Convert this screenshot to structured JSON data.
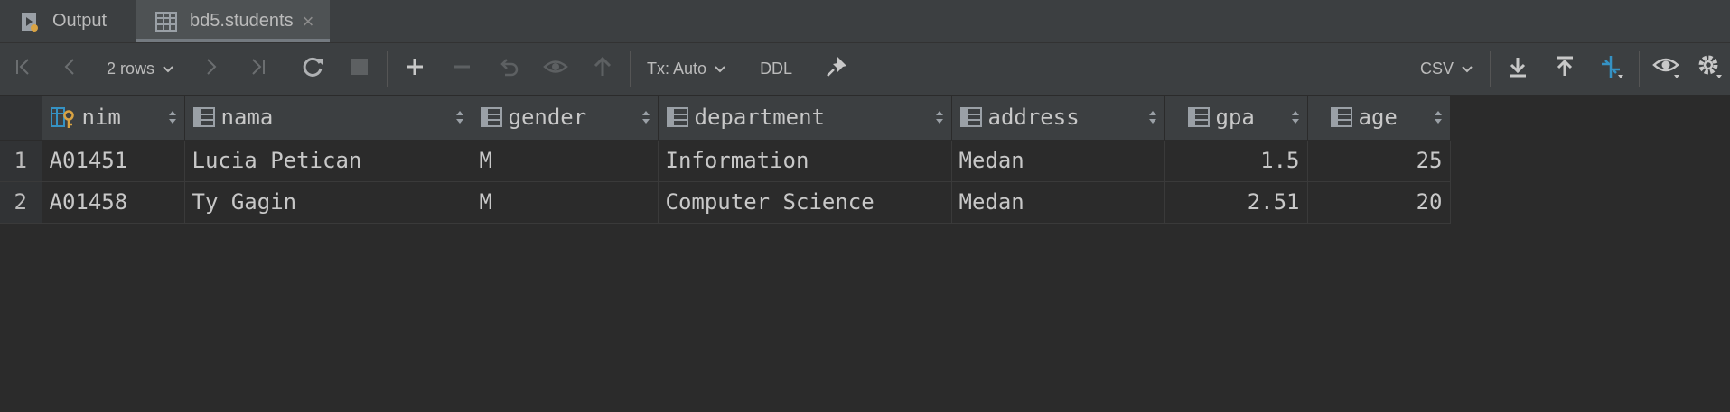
{
  "tabs": [
    {
      "label": "Output",
      "icon": "output-icon"
    },
    {
      "label": "bd5.students",
      "icon": "table-icon",
      "active": true
    }
  ],
  "toolbar": {
    "rows_label": "2 rows",
    "tx_label": "Tx: Auto",
    "ddl_label": "DDL",
    "csv_label": "CSV"
  },
  "table": {
    "columns": [
      {
        "name": "nim",
        "key": true
      },
      {
        "name": "nama"
      },
      {
        "name": "gender"
      },
      {
        "name": "department"
      },
      {
        "name": "address"
      },
      {
        "name": "gpa",
        "numeric": true
      },
      {
        "name": "age",
        "numeric": true
      }
    ],
    "rows": [
      {
        "num": "1",
        "cells": [
          "A01451",
          "Lucia Petican",
          "M",
          "Information",
          "Medan",
          "1.5",
          "25"
        ]
      },
      {
        "num": "2",
        "cells": [
          "A01458",
          "Ty Gagin",
          "M",
          "Computer Science",
          "Medan",
          "2.51",
          "20"
        ]
      }
    ]
  },
  "colors": {
    "background": "#2b2b2b",
    "toolbar": "#3c3f41",
    "accent_blue": "#3592c4",
    "key_yellow": "#d9a343"
  }
}
